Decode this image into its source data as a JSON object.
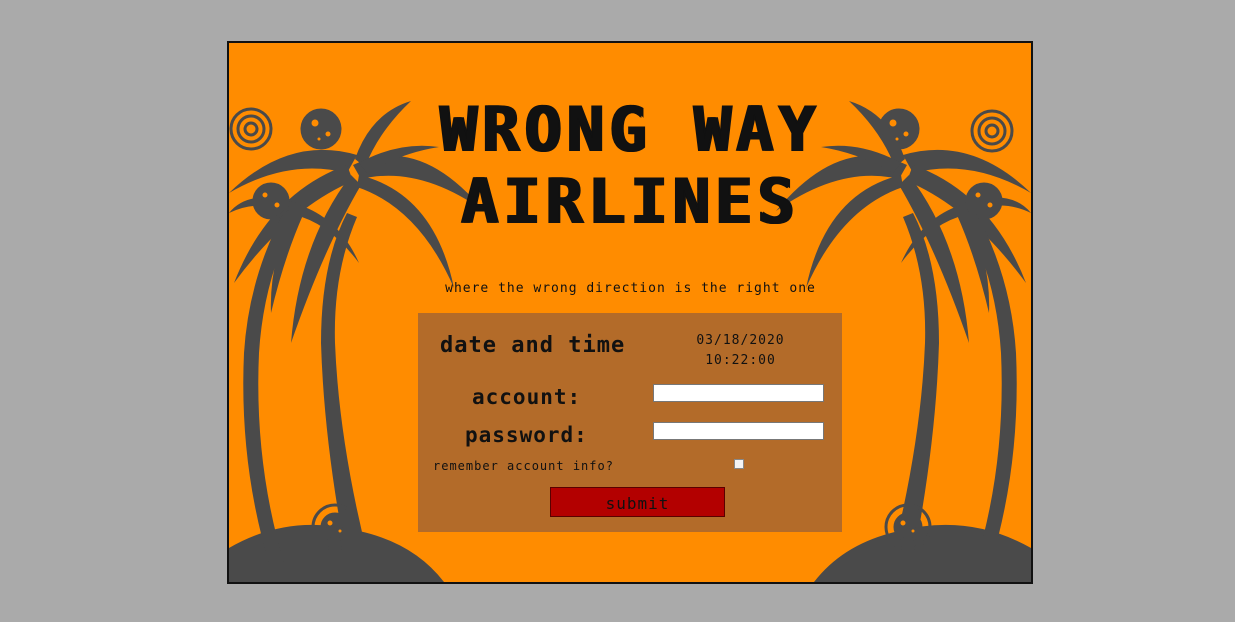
{
  "title": {
    "line1": "WRONG WAY",
    "line2": "AIRLINES"
  },
  "tagline": "where the wrong direction is the right one",
  "form": {
    "datetime_label": "date and time",
    "date": "03/18/2020",
    "time": "10:22:00",
    "account_label": "account:",
    "account_value": "",
    "password_label": "password:",
    "password_value": "",
    "remember_label": "remember account info?",
    "remember_checked": false,
    "submit_label": "submit"
  },
  "colors": {
    "page_background": "#aaaaaa",
    "frame_background": "#ff8c00",
    "panel_background": "#b36b29",
    "submit_background": "#b30000",
    "silhouette": "#4a4a4a"
  },
  "icons": [
    "palm-tree-icon",
    "sun-spiral-icon",
    "planet-icon"
  ]
}
